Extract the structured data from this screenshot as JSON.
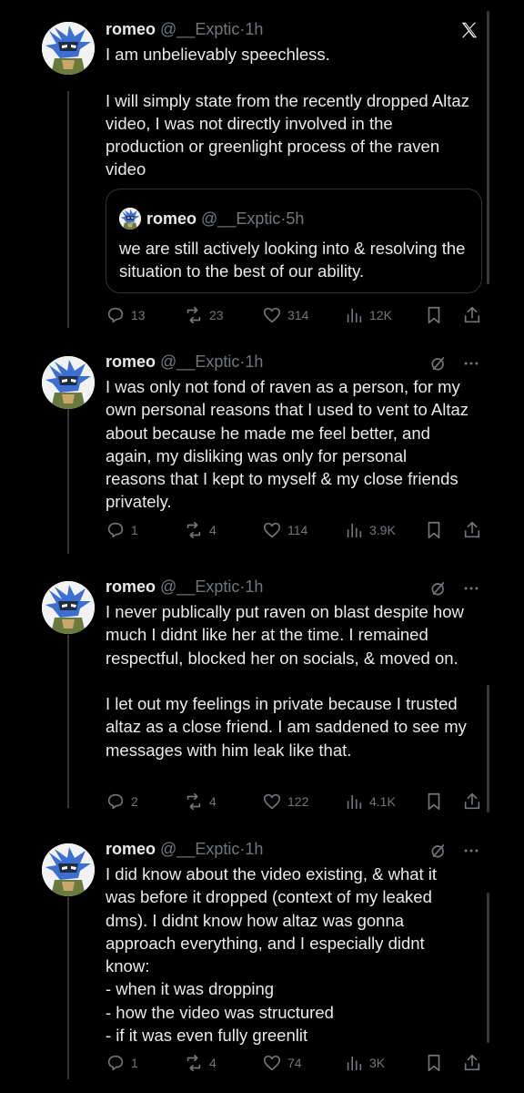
{
  "tweets": [
    {
      "name": "romeo",
      "handle": "@__Exptic",
      "separator": "·",
      "time": "1h",
      "text": "I am unbelievably speechless.\n\nI will simply state from the recently dropped Altaz video, I was not directly involved in the production or greenlight process of the raven video",
      "quote": {
        "name": "romeo",
        "handle": "@__Exptic",
        "separator": "·",
        "time": "5h",
        "text": "we are still actively looking into & resolving the situation to the best of our ability."
      },
      "stats": {
        "replies": "13",
        "reposts": "23",
        "likes": "314",
        "views": "12K"
      }
    },
    {
      "name": "romeo",
      "handle": "@__Exptic",
      "separator": "·",
      "time": "1h",
      "text": "I was only not fond of raven as a person, for my own personal reasons that I used to vent to Altaz about because he made me feel better, and again, my disliking was only for personal reasons that I kept to myself & my close friends privately.",
      "stats": {
        "replies": "1",
        "reposts": "4",
        "likes": "114",
        "views": "3.9K"
      }
    },
    {
      "name": "romeo",
      "handle": "@__Exptic",
      "separator": "·",
      "time": "1h",
      "text": "I never publically put raven on blast despite how much I didnt like her at the time. I remained respectful, blocked her on socials, & moved on.\n\nI let out my feelings in private because I trusted altaz as a close friend. I am saddened to see my messages with him leak like that.",
      "stats": {
        "replies": "2",
        "reposts": "4",
        "likes": "122",
        "views": "4.1K"
      }
    },
    {
      "name": "romeo",
      "handle": "@__Exptic",
      "separator": "·",
      "time": "1h",
      "text": "I did know about the video existing, & what it was before it dropped (context of my leaked dms). I didnt know how altaz was gonna approach everything, and I especially didnt know:\n- when it was dropping\n- how the video was structured\n- if it was even fully greenlit",
      "stats": {
        "replies": "1",
        "reposts": "4",
        "likes": "74",
        "views": "3K"
      }
    }
  ],
  "icons": {
    "close": "x-logo-icon",
    "grok": "grok-icon",
    "more": "more-icon",
    "reply": "reply-icon",
    "repost": "repost-icon",
    "like": "like-icon",
    "views": "views-icon",
    "bookmark": "bookmark-icon",
    "share": "share-icon"
  },
  "colors": {
    "background": "#000000",
    "text": "#e7e9ea",
    "secondary": "#71767b",
    "border": "#2f3336"
  }
}
